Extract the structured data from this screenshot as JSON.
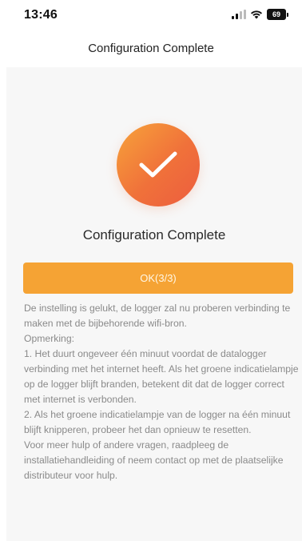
{
  "status_bar": {
    "time": "13:46",
    "battery": "69"
  },
  "header": {
    "title": "Configuration Complete"
  },
  "result": {
    "icon": "checkmark-icon",
    "title": "Configuration Complete",
    "button_label": "OK(3/3)"
  },
  "instructions": {
    "intro": "De instelling is gelukt, de logger zal nu proberen verbinding te maken met de bijbehorende wifi-bron.",
    "note_label": "Opmerking:",
    "point1": "1. Het duurt ongeveer één minuut voordat de datalogger verbinding met het internet heeft. Als het groene indicatielampje op de logger blijft branden, betekent dit dat de logger correct met internet is verbonden.",
    "point2": "2. Als het groene indicatielampje van de logger na één minuut blijft knipperen, probeer het dan opnieuw te resetten.",
    "help": "Voor meer hulp of andere vragen, raadpleeg de installatiehandleiding of neem contact op met de plaatselijke distributeur voor hulp."
  },
  "colors": {
    "accent": "#f5a334",
    "success_gradient_start": "#f7a33a",
    "success_gradient_end": "#ec5d3f",
    "card_background": "#f7f7f7",
    "muted_text": "#8a8a8a"
  }
}
